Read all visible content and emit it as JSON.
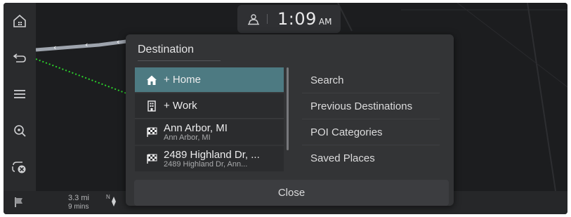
{
  "clock": {
    "time": "1:09",
    "ampm": "AM",
    "icon": "user-sync-icon"
  },
  "rail": [
    {
      "name": "home-menu-icon"
    },
    {
      "name": "back-arrow-icon"
    },
    {
      "name": "menu-icon"
    },
    {
      "name": "zoom-search-icon"
    },
    {
      "name": "cancel-route-icon"
    }
  ],
  "status": {
    "distance": "3.3 mi",
    "duration": "9 mins",
    "compass": "N"
  },
  "dialog": {
    "title": "Destination",
    "left_items": [
      {
        "primary": "+ Home",
        "secondary": "",
        "icon": "home-icon",
        "selected": true
      },
      {
        "primary": "+ Work",
        "secondary": "",
        "icon": "building-icon",
        "selected": false
      },
      {
        "primary": "Ann Arbor, MI",
        "secondary": "Ann Arbor, MI",
        "icon": "checkered-flag-icon",
        "selected": false
      },
      {
        "primary": "2489 Highland Dr, ...",
        "secondary": "2489 Highland Dr, Ann...",
        "icon": "checkered-flag-icon",
        "selected": false
      }
    ],
    "right_items": [
      {
        "label": "Search"
      },
      {
        "label": "Previous Destinations"
      },
      {
        "label": "POI Categories"
      },
      {
        "label": "Saved Places"
      }
    ],
    "close_label": "Close"
  },
  "colors": {
    "accent": "#4d7a82",
    "route": "#9ea4ad",
    "path": "#2bd12b"
  }
}
